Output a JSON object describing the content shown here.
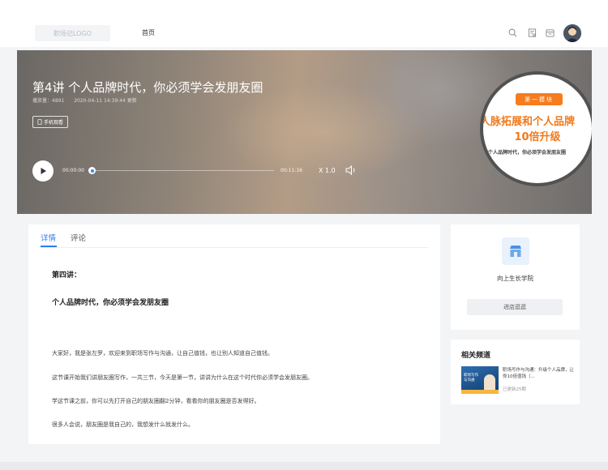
{
  "nav": {
    "logo": "职场记LOGO",
    "home": "首页",
    "icons": [
      "search-icon",
      "book-icon",
      "calendar-icon"
    ]
  },
  "hero": {
    "title": "第4讲 个人品牌时代，你必须学会发朋友圈",
    "plays": "播放量：4891",
    "updated": "2020-04-11 14:39:44 更新",
    "phone_button": "手机观看",
    "player": {
      "current_time": "00:00:00",
      "total_time": "00:11:16",
      "speed": "X 1.0",
      "progress": 0
    },
    "cover": {
      "tag": "第一模块",
      "line1": "人脉拓展和个人品牌",
      "line2": "10倍升级",
      "line3": "个人品牌时代，你必须学会发朋友圈"
    }
  },
  "tabs": [
    {
      "label": "详情",
      "active": true
    },
    {
      "label": "评论",
      "active": false
    }
  ],
  "article": {
    "heading1": "第四讲：",
    "heading2": "个人品牌时代，你必须学会发朋友圈",
    "paragraphs": [
      "大家好，我是张左罗，欢迎来到职场写作与沟通，让自己值钱，也让别人知道自己值钱。",
      "这节课开始我们讲朋友圈写作，一共三节，今天是第一节，讲讲为什么在这个时代你必须学会发朋友圈。",
      "学这节课之前，你可以先打开自己的朋友圈翻2分钟，看看你的朋友圈是否发得好。",
      "很多人会说，朋友圈是我自己的，我想发什么就发什么。"
    ]
  },
  "shop": {
    "name": "向上生长学院",
    "button": "进店逛逛"
  },
  "related": {
    "title": "相关频道",
    "thumb_line1": "职场写作",
    "thumb_line2": "与沟通",
    "description": "职场写作与沟通：升级个人品牌，让你10倍值钱（...",
    "update": "已更新25期"
  },
  "colors": {
    "accent": "#2e7cf6",
    "cover_orange": "#f07a1c"
  }
}
